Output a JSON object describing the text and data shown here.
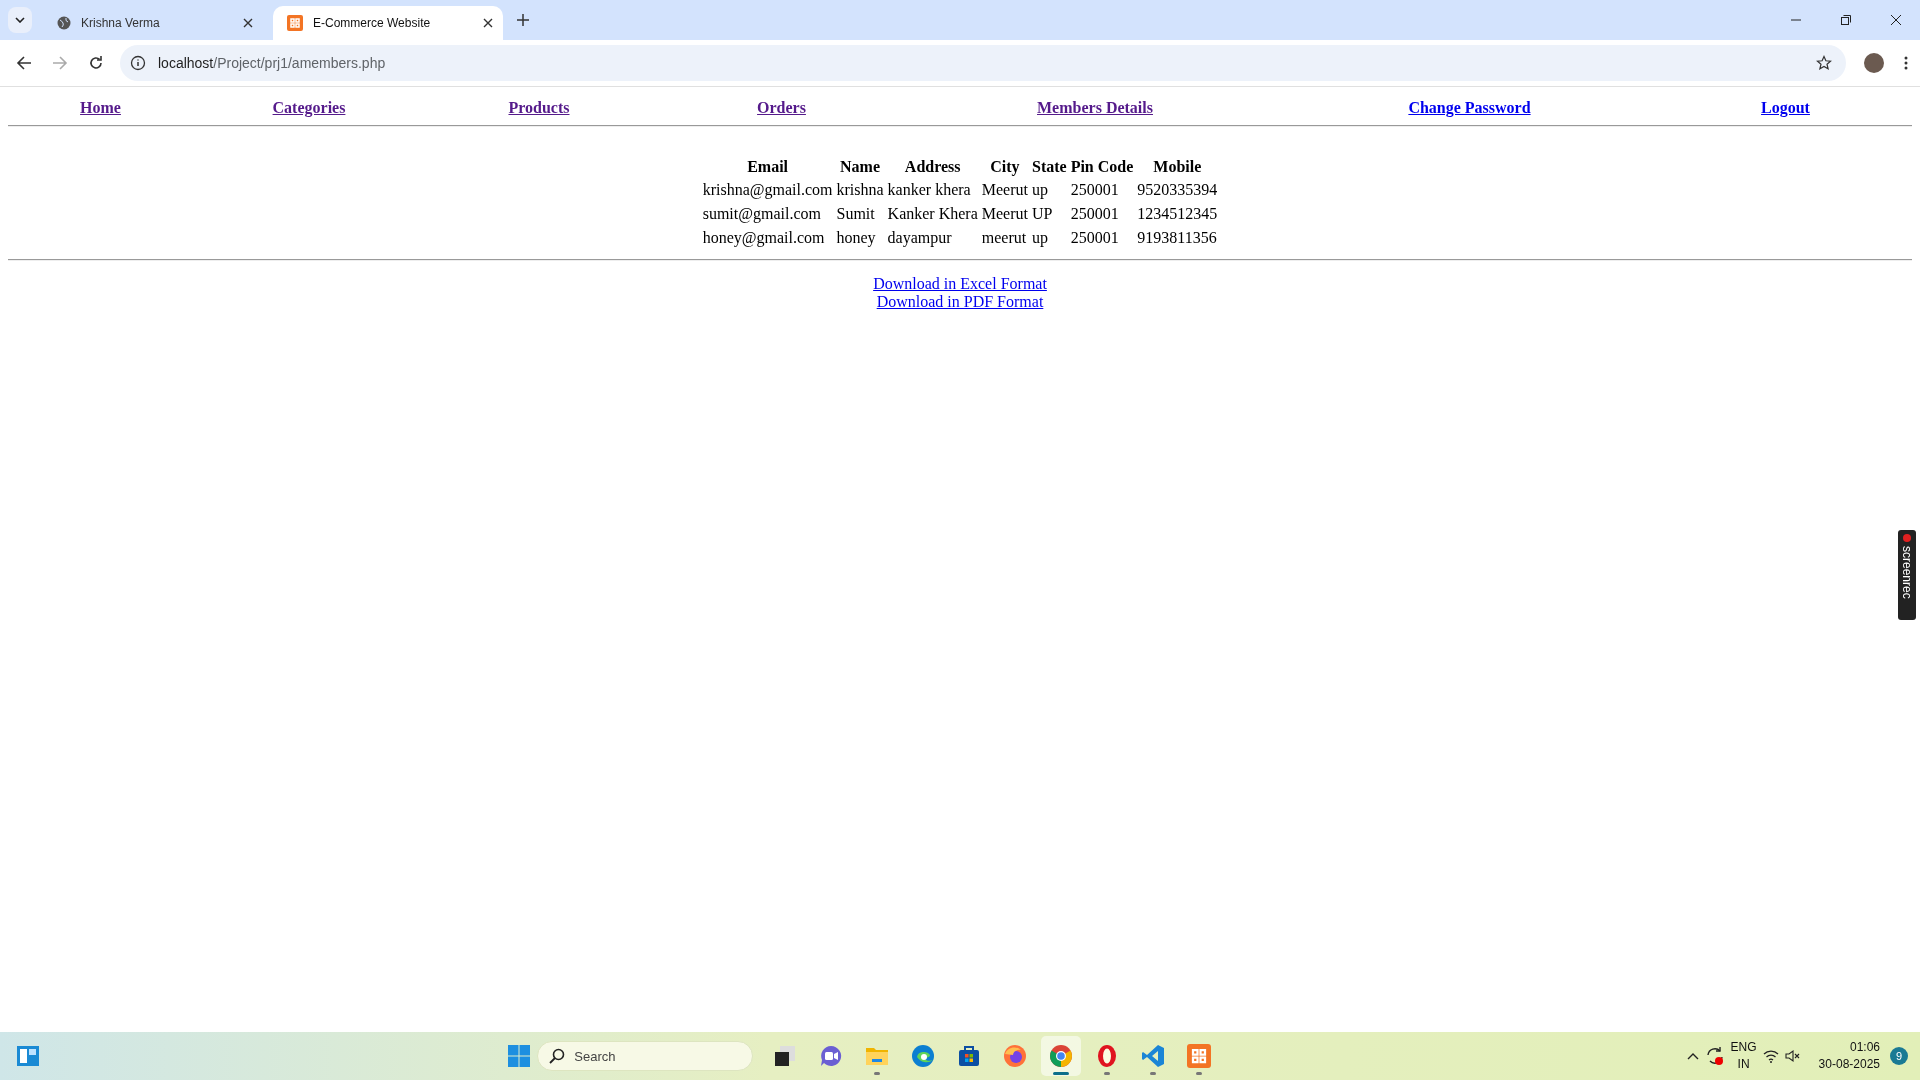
{
  "browser": {
    "tabs": [
      {
        "title": "Krishna Verma",
        "selected": false,
        "kind": "globe"
      },
      {
        "title": "E-Commerce Website",
        "selected": true,
        "kind": "xampp"
      }
    ],
    "url_host": "localhost",
    "url_path": "/Project/prj1/amembers.php"
  },
  "nav": [
    {
      "label": "Home",
      "visited": true
    },
    {
      "label": "Categories",
      "visited": true
    },
    {
      "label": "Products",
      "visited": true
    },
    {
      "label": "Orders",
      "visited": true
    },
    {
      "label": "Members Details",
      "visited": true
    },
    {
      "label": "Change Password",
      "visited": false
    },
    {
      "label": "Logout",
      "visited": false
    }
  ],
  "table": {
    "columns": [
      "Email",
      "Name",
      "Address",
      "City",
      "State",
      "Pin Code",
      "Mobile"
    ],
    "rows": [
      [
        "krishna@gmail.com",
        "krishna",
        "kanker khera",
        "Meerut",
        "up",
        "250001",
        "9520335394"
      ],
      [
        "sumit@gmail.com",
        "Sumit",
        "Kanker Khera",
        "Meerut",
        "UP",
        "250001",
        "1234512345"
      ],
      [
        "honey@gmail.com",
        "honey",
        "dayampur",
        "meerut",
        "up",
        "250001",
        "9193811356"
      ]
    ]
  },
  "downloads": [
    "Download in Excel Format",
    "Download in PDF Format"
  ],
  "recorder_label": "screenrec",
  "taskbar": {
    "search": {
      "placeholder": "Search"
    },
    "apps": [
      {
        "kind": "taskview",
        "running": false,
        "selected": false
      },
      {
        "kind": "meet",
        "running": false,
        "selected": false
      },
      {
        "kind": "folder",
        "running": true,
        "selected": false
      },
      {
        "kind": "edge",
        "running": false,
        "selected": false
      },
      {
        "kind": "store",
        "running": false,
        "selected": false
      },
      {
        "kind": "firefox",
        "running": false,
        "selected": false
      },
      {
        "kind": "chrome",
        "running": true,
        "selected": true
      },
      {
        "kind": "opera",
        "running": true,
        "selected": false
      },
      {
        "kind": "vscode",
        "running": true,
        "selected": false
      },
      {
        "kind": "xampp",
        "running": true,
        "selected": false
      }
    ],
    "language": [
      "ENG",
      "IN"
    ],
    "time": "01:06",
    "date": "30-08-2025",
    "notifications": "9"
  }
}
